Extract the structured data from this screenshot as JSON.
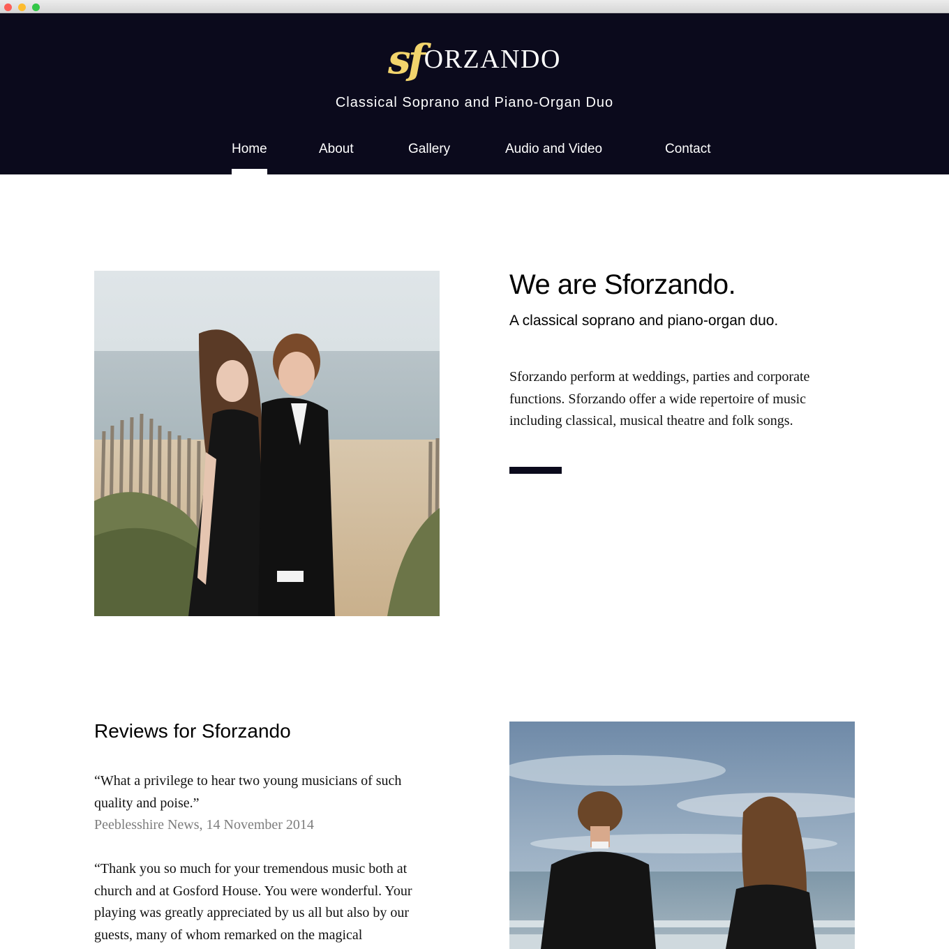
{
  "browser": {
    "buttons": [
      "close",
      "minimize",
      "zoom"
    ]
  },
  "site": {
    "logo": {
      "monogram": "sf",
      "word": "ORZANDO",
      "monogram_color": "#f2d46c"
    },
    "tagline": "Classical Soprano and Piano-Organ Duo",
    "header_color": "#0b0a1c"
  },
  "nav": {
    "items": [
      {
        "label": "Home",
        "active": true
      },
      {
        "label": "About",
        "active": false
      },
      {
        "label": "Gallery",
        "active": false
      },
      {
        "label": "Audio and Video",
        "active": false
      },
      {
        "label": "Contact",
        "active": false
      }
    ]
  },
  "hero": {
    "title": "We are Sforzando.",
    "subtitle": "A classical soprano and piano-organ duo.",
    "body": "Sforzando perform at weddings, parties and corporate functions. Sforzando offer a wide repertoire of music including classical, musical theatre and folk songs."
  },
  "reviews": {
    "title": "Reviews for Sforzando",
    "items": [
      {
        "quote": "“What a privilege to hear two young musicians of such quality and poise.”",
        "source": "Peeblesshire News, 14 November 2014"
      },
      {
        "quote": "“Thank you so much for your tremendous music both at church and at Gosford House. You were wonderful. Your playing was greatly appreciated by us all but also by our guests, many of whom remarked on the magical",
        "source": ""
      }
    ]
  }
}
